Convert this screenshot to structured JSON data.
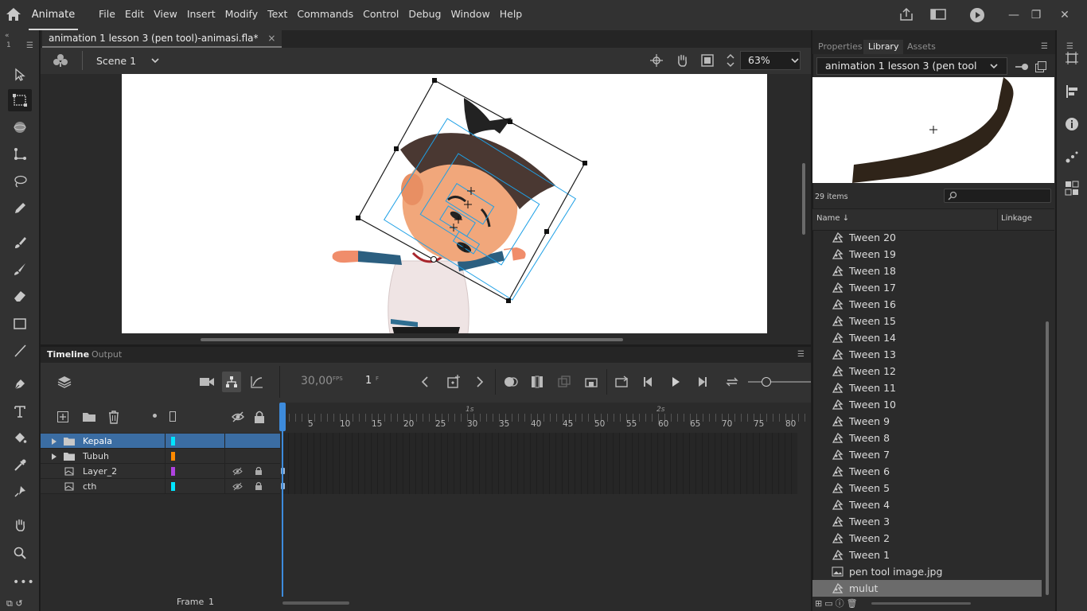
{
  "app": {
    "name": "Animate",
    "menus": [
      "File",
      "Edit",
      "View",
      "Insert",
      "Modify",
      "Text",
      "Commands",
      "Control",
      "Debug",
      "Window",
      "Help"
    ]
  },
  "document": {
    "tab_title": "animation 1 lesson 3 (pen tool)-animasi.fla*",
    "close_glyph": "×"
  },
  "scene": {
    "name": "Scene 1",
    "zoom": "63%"
  },
  "timeline": {
    "tabs": [
      "Timeline",
      "Output"
    ],
    "fps_value": "30,00",
    "fps_unit": "FPS",
    "current_frame": "1",
    "current_frame_unit": "F",
    "seconds_markers": [
      "1s",
      "2s"
    ],
    "ruler_ticks": [
      "5",
      "10",
      "15",
      "20",
      "25",
      "30",
      "35",
      "40",
      "45",
      "50",
      "55",
      "60",
      "65",
      "70",
      "75",
      "80"
    ],
    "layers": [
      {
        "name": "Kepala",
        "type": "folder",
        "color": "#00e5ff",
        "selected": true
      },
      {
        "name": "Tubuh",
        "type": "folder",
        "color": "#ff8a00",
        "selected": false
      },
      {
        "name": "Layer_2",
        "type": "layer",
        "color": "#b043e0",
        "selected": false
      },
      {
        "name": "cth",
        "type": "layer",
        "color": "#00e5ff",
        "selected": false
      }
    ],
    "frame_label": "Frame",
    "frame_value": "1"
  },
  "right_panel": {
    "tabs": [
      "Properties",
      "Library",
      "Assets"
    ],
    "active_tab": "Library",
    "library_name": "animation 1 lesson 3 (pen tool)...",
    "item_count": "29 items",
    "columns": {
      "name": "Name",
      "linkage": "Linkage"
    },
    "items": [
      {
        "name": "Tween 20",
        "icon": "graphic-symbol-icon"
      },
      {
        "name": "Tween 19",
        "icon": "graphic-symbol-icon"
      },
      {
        "name": "Tween 18",
        "icon": "graphic-symbol-icon"
      },
      {
        "name": "Tween 17",
        "icon": "graphic-symbol-icon"
      },
      {
        "name": "Tween 16",
        "icon": "graphic-symbol-icon"
      },
      {
        "name": "Tween 15",
        "icon": "graphic-symbol-icon"
      },
      {
        "name": "Tween 14",
        "icon": "graphic-symbol-icon"
      },
      {
        "name": "Tween 13",
        "icon": "graphic-symbol-icon"
      },
      {
        "name": "Tween 12",
        "icon": "graphic-symbol-icon"
      },
      {
        "name": "Tween 11",
        "icon": "graphic-symbol-icon"
      },
      {
        "name": "Tween 10",
        "icon": "graphic-symbol-icon"
      },
      {
        "name": "Tween 9",
        "icon": "graphic-symbol-icon"
      },
      {
        "name": "Tween 8",
        "icon": "graphic-symbol-icon"
      },
      {
        "name": "Tween 7",
        "icon": "graphic-symbol-icon"
      },
      {
        "name": "Tween 6",
        "icon": "graphic-symbol-icon"
      },
      {
        "name": "Tween 5",
        "icon": "graphic-symbol-icon"
      },
      {
        "name": "Tween 4",
        "icon": "graphic-symbol-icon"
      },
      {
        "name": "Tween 3",
        "icon": "graphic-symbol-icon"
      },
      {
        "name": "Tween 2",
        "icon": "graphic-symbol-icon"
      },
      {
        "name": "Tween 1",
        "icon": "graphic-symbol-icon"
      },
      {
        "name": "pen tool image.jpg",
        "icon": "bitmap-icon"
      },
      {
        "name": "mulut",
        "icon": "graphic-symbol-icon",
        "selected": true
      }
    ]
  },
  "colors": {
    "selection": "#3b6da3",
    "playhead": "#3d8bdc",
    "transform_frame": "#1a1a1a",
    "bounds": "#1ea0e6"
  }
}
